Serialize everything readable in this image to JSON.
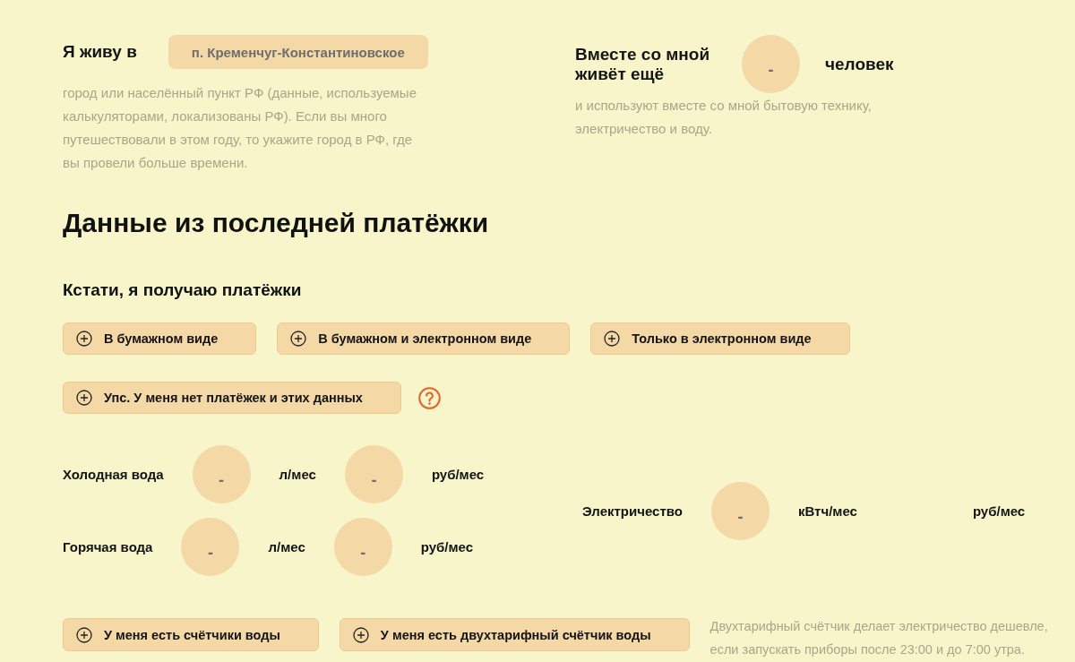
{
  "residence": {
    "label": "Я живу в",
    "city": {
      "value": "п. Кременчуг-Константиновское"
    },
    "hint": "город или населённый пункт РФ (данные, используемые калькуляторами, локализованы РФ). Если вы много путешествовали в этом году, то укажите город в РФ, где вы провели больше времени."
  },
  "household": {
    "label": "Вместе со мной живёт ещё",
    "count": {
      "value": "-"
    },
    "unit": "человек",
    "hint": "и используют вместе со мной бытовую технику, электричество и воду."
  },
  "section_title": "Данные из последней платёжки",
  "receipts": {
    "title": "Кстати, я получаю платёжки",
    "options": [
      {
        "label": "В бумажном виде",
        "selected": false
      },
      {
        "label": "В бумажном и электронном виде",
        "selected": false
      },
      {
        "label": "Только в электронном виде",
        "selected": false
      },
      {
        "label": "Упс. У меня нет платёжек и этих данных",
        "selected": false
      }
    ]
  },
  "water": [
    {
      "label": "Холодная вода",
      "parts": [
        {
          "kind": "input",
          "value": "-"
        },
        {
          "kind": "unit",
          "text": "л/мес"
        },
        {
          "kind": "input",
          "value": "-"
        },
        {
          "kind": "unit",
          "text": "руб/мес"
        }
      ]
    },
    {
      "label": "Горячая вода",
      "parts": [
        {
          "kind": "input",
          "value": "-"
        },
        {
          "kind": "unit",
          "text": "л/мес"
        },
        {
          "kind": "input",
          "value": "-"
        },
        {
          "kind": "unit",
          "text": "руб/мес"
        }
      ]
    }
  ],
  "electricity": {
    "label": "Электричество",
    "parts": [
      {
        "kind": "input",
        "value": "-"
      },
      {
        "kind": "unit",
        "text": "кВтч/мес"
      },
      {
        "kind": "unit",
        "text": "руб/мес"
      }
    ]
  },
  "meter_options": [
    {
      "label": "У меня есть счётчики воды",
      "selected": false
    },
    {
      "label": "У меня есть двухтарифный счётчик воды",
      "selected": false
    }
  ],
  "tariff_note": "Двухтарифный счётчик делает электричество дешевле, если запускать приборы после 23:00 и до 7:00 утра."
}
